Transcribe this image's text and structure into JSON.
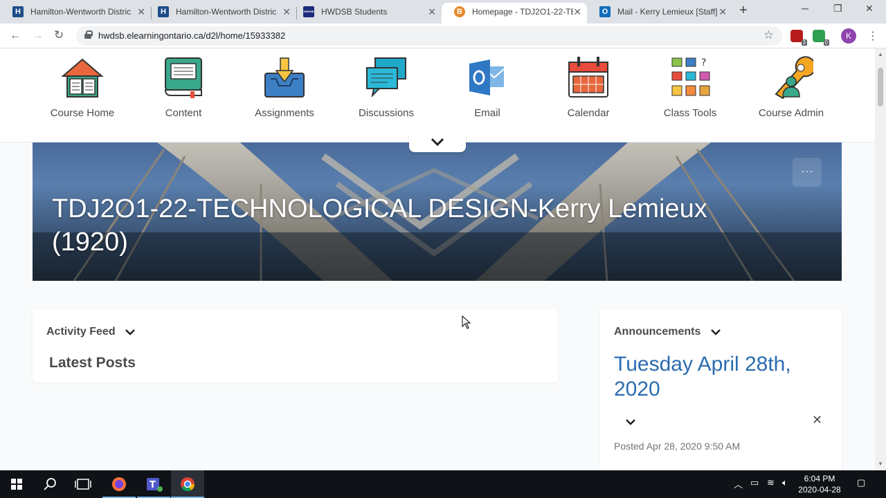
{
  "browser": {
    "tabs": [
      {
        "title": "Hamilton-Wentworth Distric",
        "favicon": "H"
      },
      {
        "title": "Hamilton-Wentworth Distric",
        "favicon": "H"
      },
      {
        "title": "HWDSB Students",
        "favicon": "HWDSB"
      },
      {
        "title": "Homepage - TDJ2O1-22-TE",
        "favicon": "B"
      },
      {
        "title": "Mail - Kerry Lemieux [Staff]",
        "favicon": "O"
      }
    ],
    "url": "hwdsb.elearningontario.ca/d2l/home/15933382",
    "extensions": [
      {
        "badge": "3"
      },
      {
        "badge": "0"
      }
    ],
    "profile_initial": "K"
  },
  "course_nav": {
    "items": [
      {
        "label": "Course Home",
        "icon": "book-icon"
      },
      {
        "label": "Content",
        "icon": "textbook-icon"
      },
      {
        "label": "Assignments",
        "icon": "inbox-tray-icon"
      },
      {
        "label": "Discussions",
        "icon": "chat-bubbles-icon"
      },
      {
        "label": "Email",
        "icon": "outlook-icon"
      },
      {
        "label": "Calendar",
        "icon": "calendar-icon"
      },
      {
        "label": "Class Tools",
        "icon": "tools-grid-icon"
      },
      {
        "label": "Course Admin",
        "icon": "wrench-user-icon"
      }
    ]
  },
  "banner": {
    "title": "TDJ2O1-22-TECHNOLOGICAL DESIGN-Kerry Lemieux (1920)"
  },
  "activity_feed": {
    "heading": "Activity Feed",
    "subheading": "Latest Posts"
  },
  "announcements": {
    "heading": "Announcements",
    "title": "Tuesday April 28th, 2020",
    "posted": "Posted Apr 28, 2020 9:50 AM"
  },
  "taskbar": {
    "time": "6:04 PM",
    "date": "2020-04-28"
  },
  "colors": {
    "link_blue": "#2a6cb0",
    "text_gray": "#494c4e",
    "chrome_gray": "#dee1e6"
  }
}
